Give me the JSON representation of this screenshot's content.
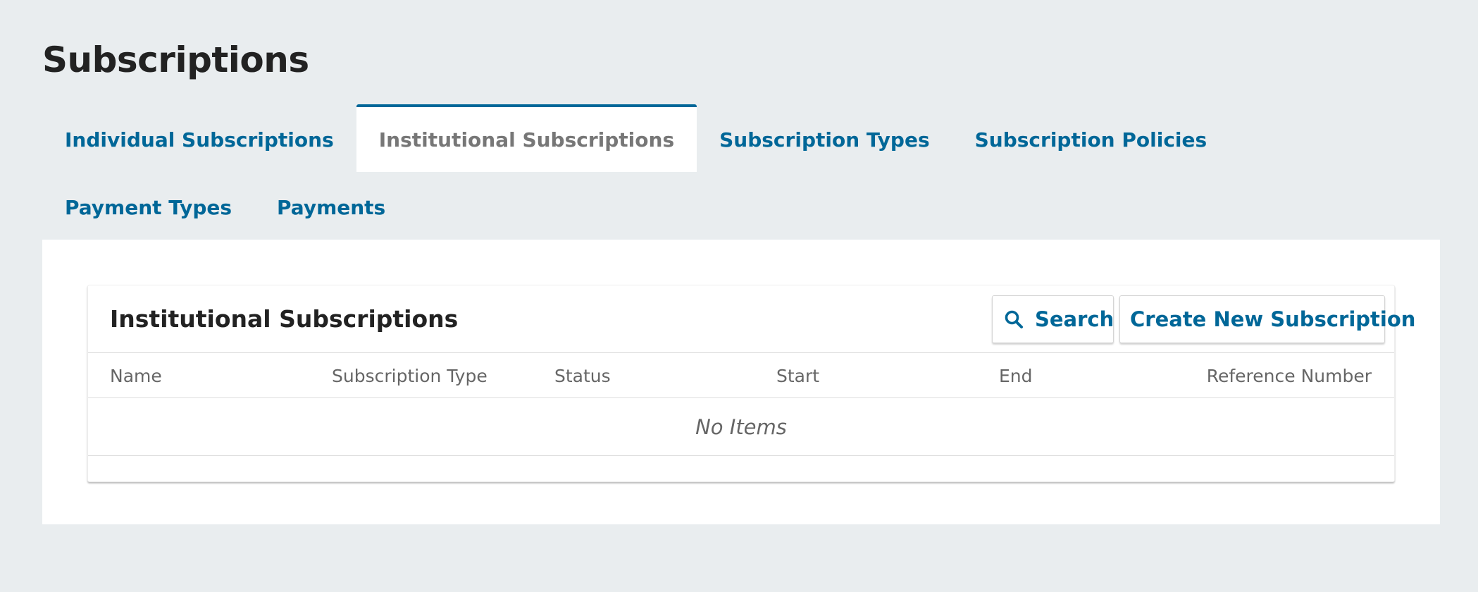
{
  "page": {
    "title": "Subscriptions"
  },
  "tabs": [
    {
      "label": "Individual Subscriptions",
      "active": false
    },
    {
      "label": "Institutional Subscriptions",
      "active": true
    },
    {
      "label": "Subscription Types",
      "active": false
    },
    {
      "label": "Subscription Policies",
      "active": false
    },
    {
      "label": "Payment Types",
      "active": false
    },
    {
      "label": "Payments",
      "active": false
    }
  ],
  "grid": {
    "title": "Institutional Subscriptions",
    "search_label": "Search",
    "search_icon": "search-icon",
    "create_label": "Create New Subscription",
    "columns": [
      "Name",
      "Subscription Type",
      "Status",
      "Start",
      "End",
      "Reference Number"
    ],
    "empty_text": "No Items"
  },
  "colors": {
    "link": "#006798",
    "background": "#e9edef",
    "active_tab_text": "#777777"
  }
}
